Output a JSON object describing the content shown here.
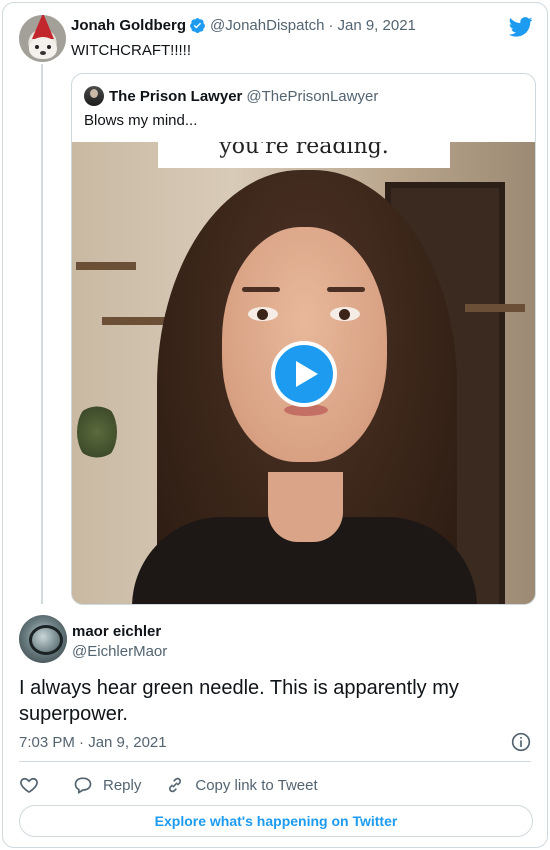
{
  "parent_tweet": {
    "author_name": "Jonah Goldberg",
    "author_handle": "@JonahDispatch",
    "separator": "·",
    "date": "Jan 9, 2021",
    "text": "WITCHCRAFT!!!!!",
    "verified": true
  },
  "quoted_tweet": {
    "author_name": "The Prison Lawyer",
    "author_handle": "@ThePrisonLawyer",
    "text": "Blows my mind...",
    "video_caption": "you're reading."
  },
  "main_tweet": {
    "author_name": "maor eichler",
    "author_handle": "@EichlerMaor",
    "text": "I always hear green needle. This is apparently my superpower.",
    "timestamp": "7:03 PM · Jan 9, 2021"
  },
  "actions": {
    "reply_label": "Reply",
    "copy_link_label": "Copy link to Tweet"
  },
  "explore_button": "Explore what's happening on Twitter",
  "icons": {
    "verified": "verified-badge-icon",
    "logo": "twitter-bird-icon",
    "play": "play-icon",
    "info": "info-icon",
    "like": "heart-icon",
    "reply": "reply-bubble-icon",
    "link": "link-icon"
  },
  "colors": {
    "accent": "#1d9bf0",
    "text": "#0f1419",
    "secondary": "#536471",
    "border": "#cfd9de"
  }
}
